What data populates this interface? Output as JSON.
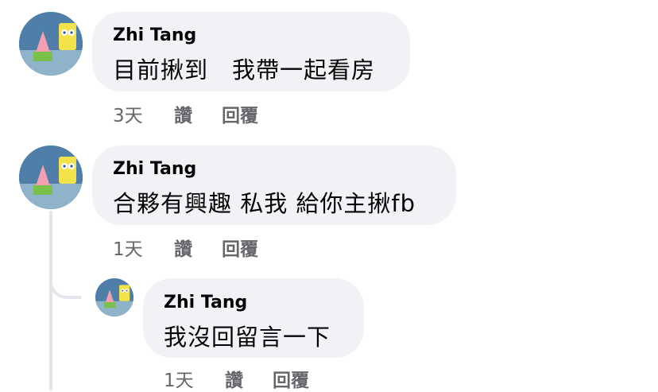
{
  "comments": [
    {
      "author": "Zhi Tang",
      "text": "目前揪到　我帶一起看房",
      "time": "3天",
      "like_label": "讚",
      "reply_label": "回覆"
    },
    {
      "author": "Zhi Tang",
      "text": "合夥有興趣 私我 給你主揪fb",
      "time": "1天",
      "like_label": "讚",
      "reply_label": "回覆"
    },
    {
      "author": "Zhi Tang",
      "text": "我沒回留言一下",
      "time": "1天",
      "like_label": "讚",
      "reply_label": "回覆"
    }
  ],
  "colors": {
    "bubble": "#f0f2f5",
    "meta": "#65676b",
    "thread_line": "#e4e6eb"
  },
  "icons": {
    "avatar": "profile-picture"
  }
}
